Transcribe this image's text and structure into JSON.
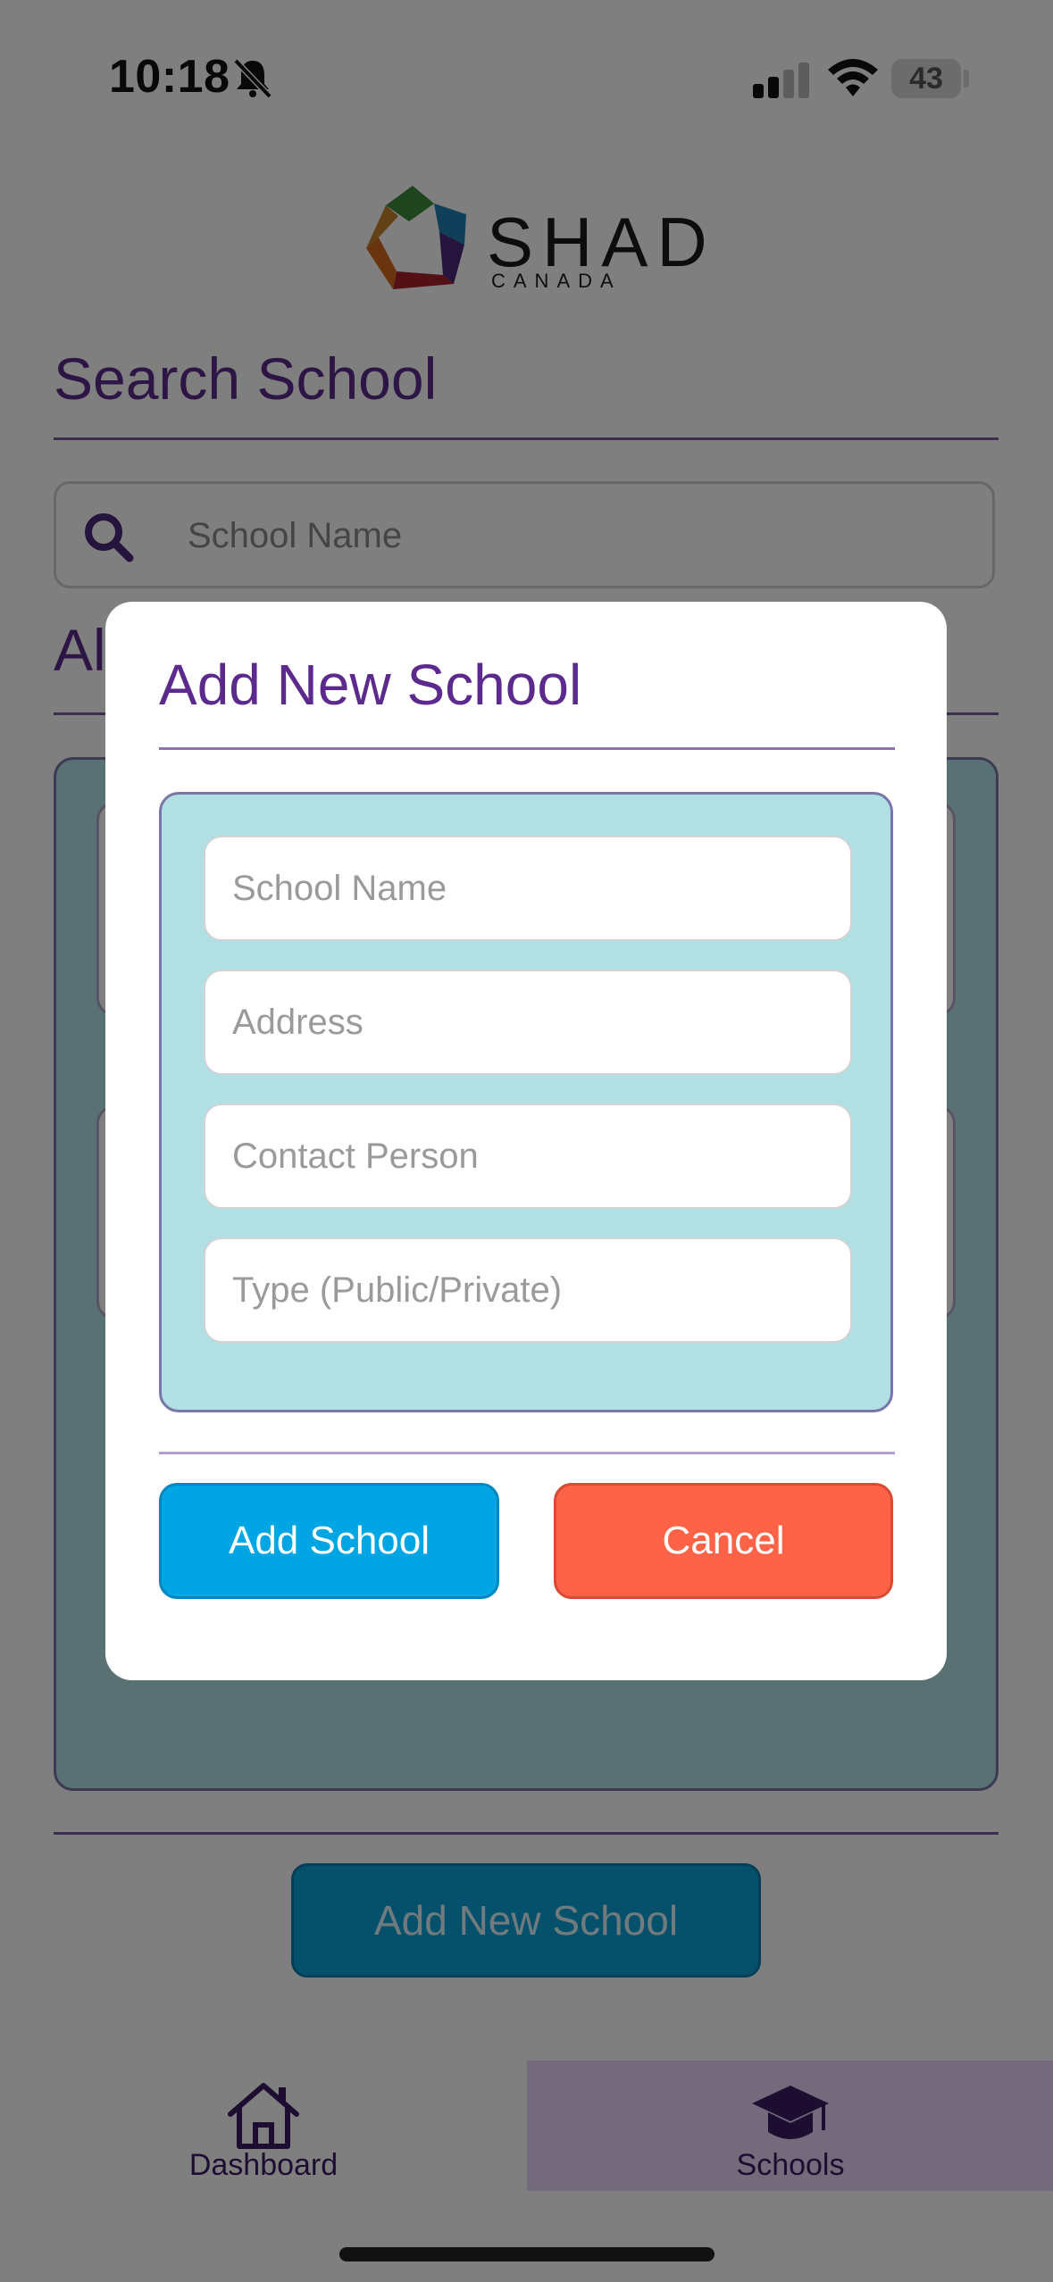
{
  "status_bar": {
    "time": "10:18",
    "battery": "43",
    "icons": [
      "bell-slash-icon",
      "signal-icon",
      "wifi-icon",
      "battery-icon"
    ]
  },
  "header": {
    "logo_word": "SHAD",
    "logo_sub": "CANADA"
  },
  "search": {
    "title": "Search School",
    "placeholder": "School Name"
  },
  "list": {
    "title": "All"
  },
  "add_new_button": "Add New School",
  "tabs": [
    {
      "label": "Dashboard",
      "icon": "home-icon",
      "active": false
    },
    {
      "label": "Schools",
      "icon": "graduation-cap-icon",
      "active": true
    }
  ],
  "modal": {
    "title": "Add New School",
    "fields": [
      {
        "placeholder": "School Name",
        "value": ""
      },
      {
        "placeholder": "Address",
        "value": ""
      },
      {
        "placeholder": "Contact Person",
        "value": ""
      },
      {
        "placeholder": "Type (Public/Private)",
        "value": ""
      }
    ],
    "add_label": "Add School",
    "cancel_label": "Cancel"
  },
  "colors": {
    "brand_purple": "#5b2a8c",
    "add_blue": "#00a6e3",
    "cancel_red": "#ff6347",
    "form_bg": "#b0e0e3"
  }
}
